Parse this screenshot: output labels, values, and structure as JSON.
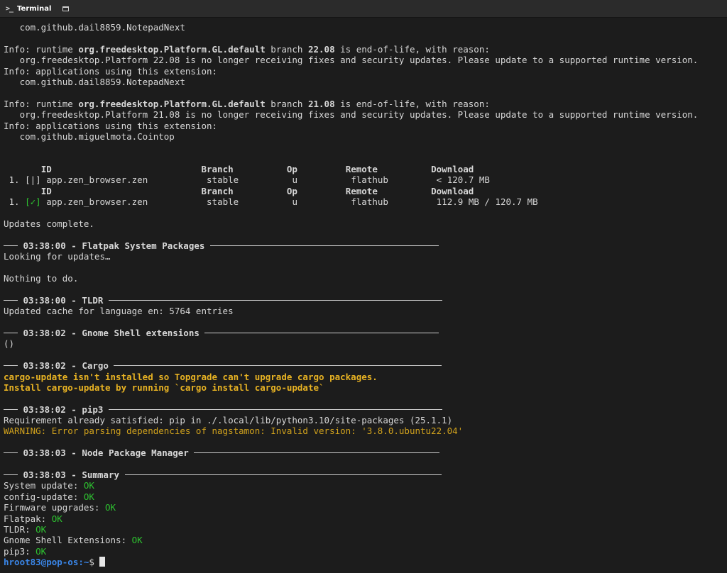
{
  "tab": {
    "title": "Terminal",
    "icon": "terminal-icon",
    "new_window_icon": "window-icon"
  },
  "colors": {
    "ok": "#2ec230",
    "warning": "#d1a21c",
    "prompt": "#3a86e8",
    "background": "#1c1c1c"
  },
  "lines": {
    "l1": "   com.github.dail8859.NotepadNext",
    "l3a": "Info: runtime ",
    "l3b": "org.freedesktop.Platform.GL.default",
    "l3c": " branch ",
    "l3d": "22.08",
    "l3e": " is end-of-life, with reason:",
    "l4": "   org.freedesktop.Platform 22.08 is no longer receiving fixes and security updates. Please update to a supported runtime version.",
    "l5": "Info: applications using this extension:",
    "l6": "   com.github.dail8859.NotepadNext",
    "l8a": "Info: runtime ",
    "l8b": "org.freedesktop.Platform.GL.default",
    "l8c": " branch ",
    "l8d": "21.08",
    "l8e": " is end-of-life, with reason:",
    "l9": "   org.freedesktop.Platform 21.08 is no longer receiving fixes and security updates. Please update to a supported runtime version.",
    "l10": "Info: applications using this extension:",
    "l11": "   com.github.miguelmota.Cointop",
    "updates_complete": "Updates complete.",
    "looking": "Looking for updates…",
    "nothing": "Nothing to do.",
    "tldr_cache": "Updated cache for language en: 5764 entries",
    "gnome_out": "()",
    "cargo_warn1": "cargo-update isn't installed so Topgrade can't upgrade cargo packages.",
    "cargo_warn2": "Install cargo-update by running `cargo install cargo-update`",
    "pip_req": "Requirement already satisfied: pip in ./.local/lib/python3.10/site-packages (25.1.1)",
    "pip_warn": "WARNING: Error parsing dependencies of nagstamon: Invalid version: '3.8.0.ubuntu22.04'"
  },
  "flatpak_table": {
    "headers": {
      "id": "ID",
      "branch": "Branch",
      "op": "Op",
      "remote": "Remote",
      "download": "Download"
    },
    "rows": [
      {
        "num": "1.",
        "mark": "[|]",
        "id": "app.zen_browser.zen",
        "branch": "stable",
        "op": "u",
        "remote": "flathub",
        "download": "< 120.7 MB"
      },
      {
        "num": "1.",
        "mark": "[✓]",
        "id": "app.zen_browser.zen",
        "branch": "stable",
        "op": "u",
        "remote": "flathub",
        "download": "112.9 MB / 120.7 MB"
      }
    ]
  },
  "sections": {
    "flatpak_sys": "03:38:00 - Flatpak System Packages",
    "tldr": "03:38:00 - TLDR",
    "gnome": "03:38:02 - Gnome Shell extensions",
    "cargo": "03:38:02 - Cargo",
    "pip3": "03:38:02 - pip3",
    "npm": "03:38:03 - Node Package Manager",
    "summary": "03:38:03 - Summary"
  },
  "summary": [
    {
      "label": "System update: ",
      "status": "OK"
    },
    {
      "label": "config-update: ",
      "status": "OK"
    },
    {
      "label": "Firmware upgrades: ",
      "status": "OK"
    },
    {
      "label": "Flatpak: ",
      "status": "OK"
    },
    {
      "label": "TLDR: ",
      "status": "OK"
    },
    {
      "label": "Gnome Shell Extensions: ",
      "status": "OK"
    },
    {
      "label": "pip3: ",
      "status": "OK"
    }
  ],
  "prompt": {
    "user_host": "hroot83@pop-os",
    "path": ":~",
    "symbol": "$ "
  }
}
